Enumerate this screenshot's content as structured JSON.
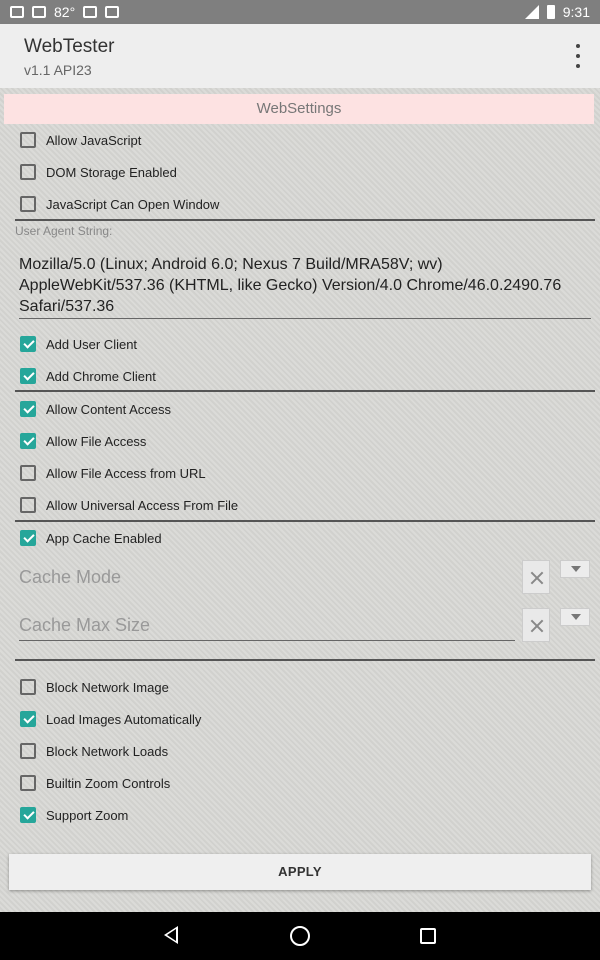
{
  "status_bar": {
    "temperature": "82°",
    "time": "9:31"
  },
  "app_bar": {
    "title": "WebTester",
    "subtitle": "v1.1 API23"
  },
  "websettings": {
    "header": "WebSettings",
    "group1": [
      {
        "label": "Allow JavaScript",
        "checked": false
      },
      {
        "label": "DOM Storage Enabled",
        "checked": false
      },
      {
        "label": "JavaScript Can Open Window",
        "checked": false
      }
    ],
    "user_agent_label": "User Agent String:",
    "user_agent_value": "Mozilla/5.0 (Linux; Android 6.0; Nexus 7 Build/MRA58V; wv) AppleWebKit/537.36 (KHTML, like Gecko) Version/4.0 Chrome/46.0.2490.76 Safari/537.36",
    "group2": [
      {
        "label": "Add User Client",
        "checked": true
      },
      {
        "label": "Add Chrome Client",
        "checked": true
      }
    ],
    "group3": [
      {
        "label": "Allow Content Access",
        "checked": true
      },
      {
        "label": "Allow File Access",
        "checked": true
      },
      {
        "label": "Allow File Access from URL",
        "checked": false
      },
      {
        "label": "Allow Universal Access From File",
        "checked": false
      }
    ],
    "group4": [
      {
        "label": "App Cache Enabled",
        "checked": true
      }
    ],
    "cache_mode_placeholder": "Cache Mode",
    "cache_max_size_placeholder": "Cache Max Size",
    "group5": [
      {
        "label": "Block Network Image",
        "checked": false
      },
      {
        "label": "Load Images Automatically",
        "checked": true
      },
      {
        "label": "Block Network Loads",
        "checked": false
      },
      {
        "label": "Builtin Zoom Controls",
        "checked": false
      },
      {
        "label": "Support Zoom",
        "checked": true
      }
    ],
    "apply_label": "APPLY"
  },
  "colors": {
    "accent": "#26a69a",
    "header_bg": "#fde2e2",
    "appbar_bg": "#eeeeee"
  }
}
